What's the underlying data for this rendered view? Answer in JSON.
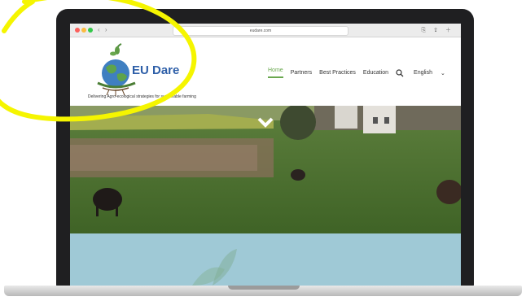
{
  "browser": {
    "url": "eudare.com",
    "nav_back_forward": "‹ ›"
  },
  "site": {
    "logo_text": "EU Dare",
    "tagline": "Delivering Agro-ecological strategies for sustainable farming",
    "search_icon": "search-icon",
    "language": "English",
    "language_chevron": "⌄"
  },
  "nav": {
    "items": [
      "Home",
      "Partners",
      "Best Practices",
      "Education"
    ]
  },
  "hero": {
    "scroll_icon": "chevron-down-icon"
  },
  "colors": {
    "nav_active": "#6aa84f",
    "logo_text": "#2e5fa8",
    "annotation": "#f5f500",
    "blue_band": "#9fc9d6"
  }
}
